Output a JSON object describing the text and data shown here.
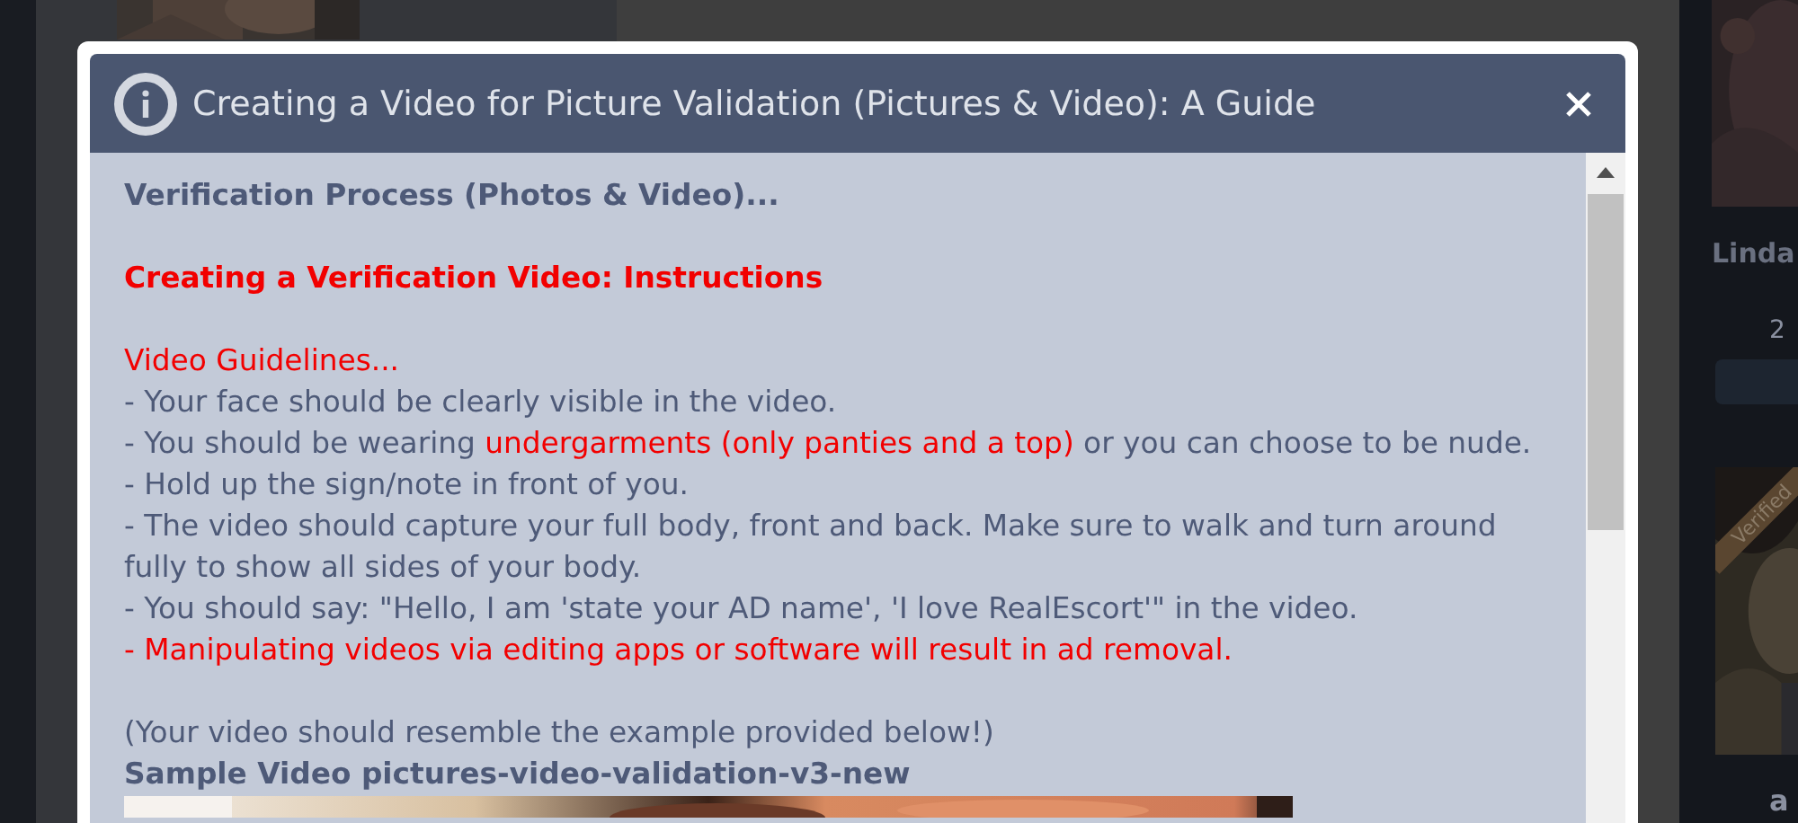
{
  "background": {
    "cards": [
      {
        "name": "Linda",
        "detail": "2"
      },
      {
        "badge": "Verified",
        "name": "a"
      }
    ]
  },
  "dialog": {
    "title": "Creating a Video for Picture Validation (Pictures & Video): A Guide",
    "blocks": [
      {
        "kind": "heading",
        "parts": [
          {
            "text": "Verification Process (Photos & Video)...",
            "highlight": false
          }
        ]
      },
      {
        "kind": "gap"
      },
      {
        "kind": "heading",
        "parts": [
          {
            "text": "Creating a Verification Video: Instructions",
            "highlight": true
          }
        ]
      },
      {
        "kind": "gap"
      },
      {
        "kind": "line",
        "parts": [
          {
            "text": "Video Guidelines...",
            "highlight": true
          }
        ]
      },
      {
        "kind": "line",
        "parts": [
          {
            "text": "- Your face should be clearly visible in the video.",
            "highlight": false
          }
        ]
      },
      {
        "kind": "line",
        "parts": [
          {
            "text": "- You should be wearing ",
            "highlight": false
          },
          {
            "text": "undergarments (only panties and a top)",
            "highlight": true
          },
          {
            "text": " or you can choose to be nude.",
            "highlight": false
          }
        ]
      },
      {
        "kind": "line",
        "parts": [
          {
            "text": "- Hold up the sign/note in front of you.",
            "highlight": false
          }
        ]
      },
      {
        "kind": "line",
        "parts": [
          {
            "text": "- The video should capture your full body, front and back. Make sure to walk and turn around fully to show all sides of your body.",
            "highlight": false
          }
        ]
      },
      {
        "kind": "line",
        "parts": [
          {
            "text": "- You should say: \"Hello, I am 'state your AD name', 'I love RealEscort'\" in the video.",
            "highlight": false
          }
        ]
      },
      {
        "kind": "line",
        "parts": [
          {
            "text": "- Manipulating videos via editing apps or software will result in ad removal.",
            "highlight": true
          }
        ]
      },
      {
        "kind": "gap"
      },
      {
        "kind": "line",
        "parts": [
          {
            "text": "(Your video should resemble the example provided below!)",
            "highlight": false
          }
        ]
      },
      {
        "kind": "heading",
        "parts": [
          {
            "text": "Sample Video pictures-video-validation-v3-new",
            "highlight": false
          }
        ]
      },
      {
        "kind": "video"
      }
    ]
  }
}
